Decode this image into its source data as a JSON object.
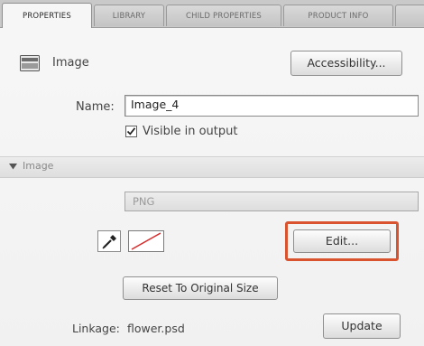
{
  "tabs": [
    {
      "label": "PROPERTIES",
      "active": true
    },
    {
      "label": "LIBRARY",
      "active": false
    },
    {
      "label": "CHILD PROPERTIES",
      "active": false
    },
    {
      "label": "PRODUCT INFO",
      "active": false
    },
    {
      "label": "",
      "active": false
    }
  ],
  "header": {
    "type_label": "Image",
    "accessibility_button": "Accessibility..."
  },
  "name_field": {
    "label": "Name:",
    "value": "Image_4"
  },
  "visible_checkbox": {
    "label": "Visible in output",
    "checked": true
  },
  "section": {
    "title": "Image",
    "expanded": true
  },
  "format_dropdown": {
    "value": "PNG"
  },
  "edit_button": "Edit...",
  "reset_button": "Reset To Original Size",
  "linkage": {
    "label": "Linkage:",
    "value": "flower.psd"
  },
  "update_button": "Update",
  "colors": {
    "highlight": "#d9532f",
    "panel_bg": "#f4f4f4",
    "tab_bg": "#c9c9c9"
  }
}
